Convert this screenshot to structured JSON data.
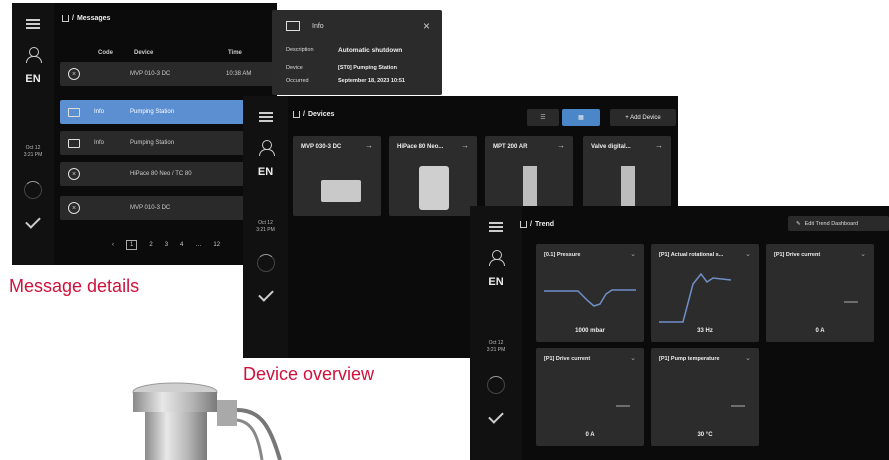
{
  "captions": {
    "messages": "Message details",
    "devices": "Device overview"
  },
  "rail": {
    "language": "EN"
  },
  "messages_screen": {
    "breadcrumb": "Messages",
    "columns": {
      "code": "Code",
      "device": "Device",
      "time": "Time"
    },
    "rows": [
      {
        "icon": "error-icon",
        "code": "",
        "device": "MVP 010-3 DC",
        "time": "10:38 AM",
        "selected": false
      },
      {
        "icon": "info-icon",
        "code": "Info",
        "device": "Pumping Station",
        "time": "",
        "selected": true
      },
      {
        "icon": "info-icon",
        "code": "Info",
        "device": "Pumping Station",
        "time": "",
        "selected": false
      },
      {
        "icon": "error-icon",
        "code": "",
        "device": "HiPace 80 Neo / TC 80",
        "time": "",
        "selected": false
      },
      {
        "icon": "error-icon",
        "code": "",
        "device": "MVP 010-3 DC",
        "time": "",
        "selected": false
      }
    ],
    "pages": [
      "1",
      "2",
      "3",
      "4",
      "12"
    ],
    "date": "Oct 12",
    "time": "3:21 PM"
  },
  "info_panel": {
    "title": "Info",
    "description_label": "Description",
    "description_value": "Automatic shutdown",
    "device_label": "Device",
    "device_value": "[ST0] Pumping Station",
    "occurred_label": "Occurred",
    "occurred_value": "September 18, 2023 10:51"
  },
  "devices_screen": {
    "breadcrumb": "Devices",
    "add_device_label": "+ Add Device",
    "devices": [
      "MVP 030-3 DC",
      "HiPace 80 Neo...",
      "MPT 200 AR",
      "Valve digital..."
    ],
    "date": "Oct 12",
    "time": "3:21 PM"
  },
  "trend_screen": {
    "breadcrumb": "Trend",
    "edit_button": "Edit Trend Dashboard",
    "date": "Oct 12",
    "time": "3:21 PM",
    "cards": [
      {
        "name": "[0.1] Pressure",
        "value": "1000 mbar"
      },
      {
        "name": "[P1] Actual rotational s...",
        "value": "33 Hz"
      },
      {
        "name": "[P1] Drive current",
        "value": "0 A"
      },
      {
        "name": "[P1] Drive current",
        "value": "0 A"
      },
      {
        "name": "[P1] Pump temperature",
        "value": "30 °C"
      }
    ]
  },
  "colors": {
    "caption": "#d0103a",
    "selected_row": "#5b8fd1",
    "trend_line": "#6f8fc8",
    "toggle_active": "#4a86c8"
  }
}
